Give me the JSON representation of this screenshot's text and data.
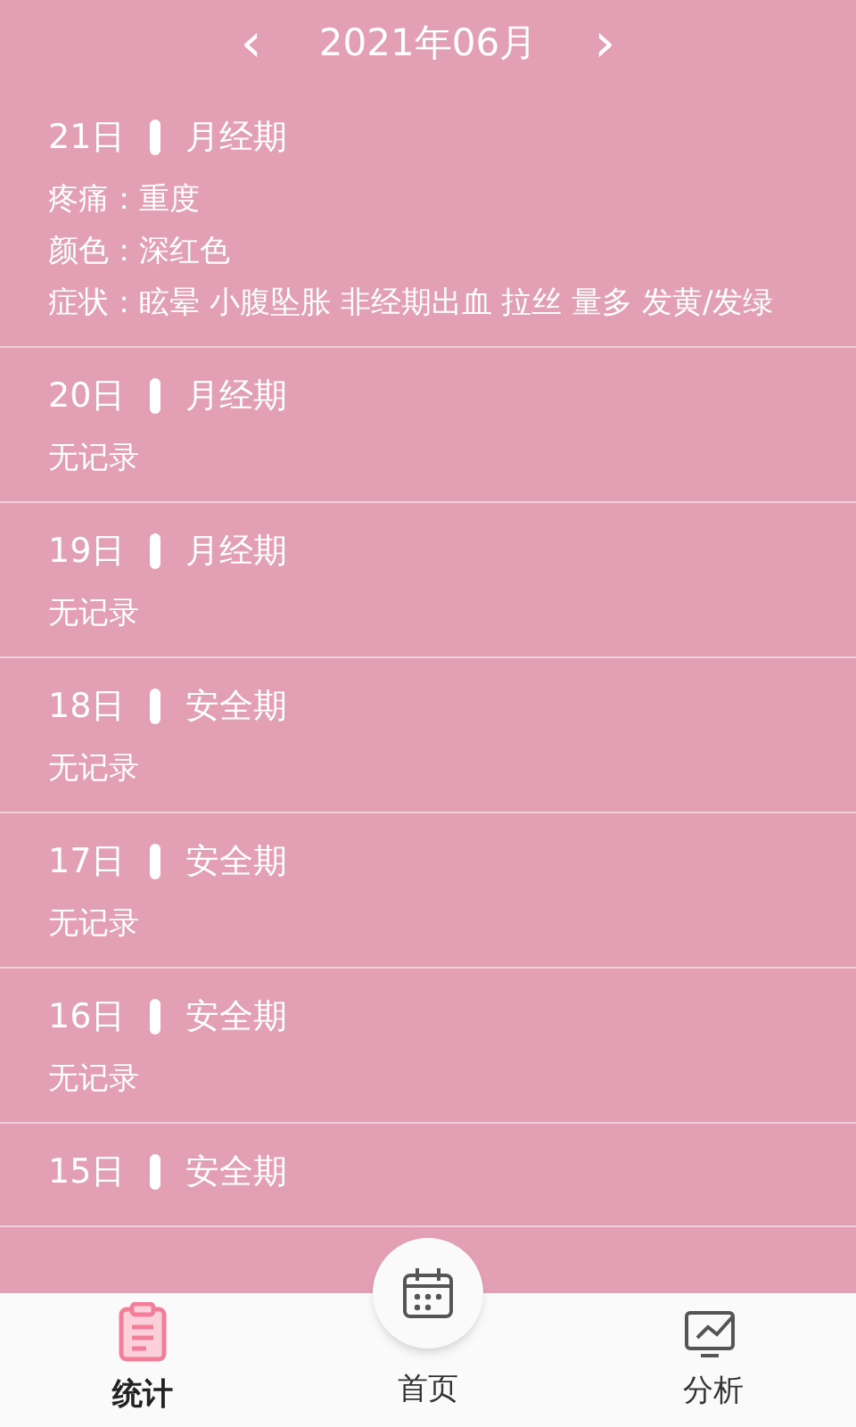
{
  "header": {
    "prev": "‹",
    "title": "2021年06月",
    "next": "›"
  },
  "days": [
    {
      "day": "21日",
      "phase": "月经期",
      "details": [
        "疼痛：重度",
        "颜色：深红色",
        "症状：眩晕 小腹坠胀 非经期出血 拉丝 量多 发黄/发绿"
      ]
    },
    {
      "day": "20日",
      "phase": "月经期",
      "details": [
        "无记录"
      ]
    },
    {
      "day": "19日",
      "phase": "月经期",
      "details": [
        "无记录"
      ]
    },
    {
      "day": "18日",
      "phase": "安全期",
      "details": [
        "无记录"
      ]
    },
    {
      "day": "17日",
      "phase": "安全期",
      "details": [
        "无记录"
      ]
    },
    {
      "day": "16日",
      "phase": "安全期",
      "details": [
        "无记录"
      ]
    },
    {
      "day": "15日",
      "phase": "安全期"
    }
  ],
  "nav": [
    {
      "label": "统计",
      "kind": "clipboard",
      "selected": true
    },
    {
      "label": "首页",
      "kind": "calendar",
      "selected": false
    },
    {
      "label": "分析",
      "kind": "chart",
      "selected": false
    }
  ]
}
